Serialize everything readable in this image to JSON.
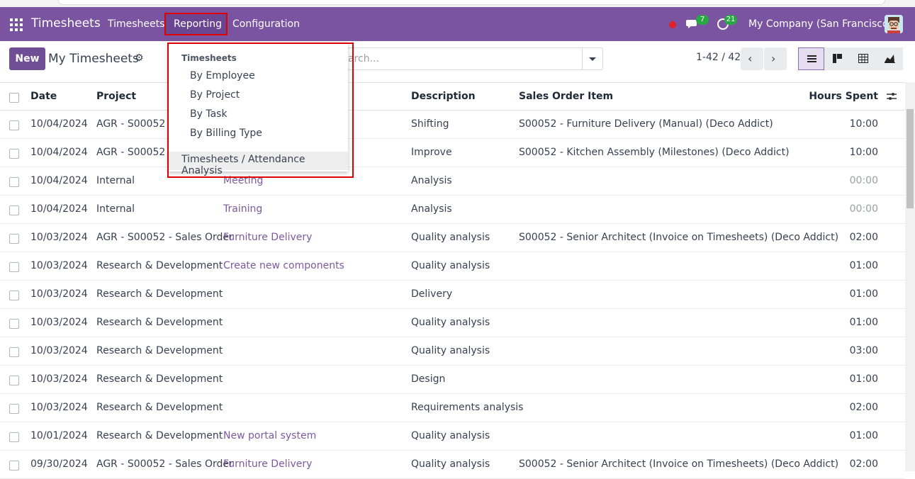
{
  "app": {
    "brand": "Timesheets",
    "menu": [
      "Timesheets",
      "Reporting",
      "Configuration"
    ],
    "chat_count": "7",
    "activity_count": "21",
    "company": "My Company (San Francisco)"
  },
  "control": {
    "new_label": "New",
    "page_title": "My Timesheets",
    "search_placeholder": "arch...",
    "pager": "1-42 / 42"
  },
  "table": {
    "headers": [
      "Date",
      "Project",
      "Description",
      "Sales Order Item",
      "Hours Spent"
    ],
    "rows": [
      {
        "date": "10/04/2024",
        "project": "AGR - S00052 - S",
        "task": "",
        "desc": "Shifting",
        "soi": "S00052 - Furniture Delivery (Manual) (Deco Addict)",
        "hours": "10:00"
      },
      {
        "date": "10/04/2024",
        "project": "AGR - S00052 - S",
        "task": "",
        "desc": "Improve",
        "soi": "S00052 - Kitchen Assembly (Milestones) (Deco Addict)",
        "hours": "10:00"
      },
      {
        "date": "10/04/2024",
        "project": "Internal",
        "task": "Meeting",
        "desc": "Analysis",
        "soi": "",
        "hours": "00:00"
      },
      {
        "date": "10/04/2024",
        "project": "Internal",
        "task": "Training",
        "desc": "Analysis",
        "soi": "",
        "hours": "00:00"
      },
      {
        "date": "10/03/2024",
        "project": "AGR - S00052 - Sales Order",
        "task": "Furniture Delivery",
        "desc": "Quality analysis",
        "soi": "S00052 - Senior Architect (Invoice on Timesheets) (Deco Addict)",
        "hours": "02:00"
      },
      {
        "date": "10/03/2024",
        "project": "Research & Development",
        "task": "Create new components",
        "desc": "Quality analysis",
        "soi": "",
        "hours": "01:00"
      },
      {
        "date": "10/03/2024",
        "project": "Research & Development",
        "task": "",
        "desc": "Delivery",
        "soi": "",
        "hours": "01:00"
      },
      {
        "date": "10/03/2024",
        "project": "Research & Development",
        "task": "",
        "desc": "Quality analysis",
        "soi": "",
        "hours": "01:00"
      },
      {
        "date": "10/03/2024",
        "project": "Research & Development",
        "task": "",
        "desc": "Quality analysis",
        "soi": "",
        "hours": "03:00"
      },
      {
        "date": "10/03/2024",
        "project": "Research & Development",
        "task": "",
        "desc": "Design",
        "soi": "",
        "hours": "01:00"
      },
      {
        "date": "10/03/2024",
        "project": "Research & Development",
        "task": "",
        "desc": "Requirements analysis",
        "soi": "",
        "hours": "02:00"
      },
      {
        "date": "10/01/2024",
        "project": "Research & Development",
        "task": "New portal system",
        "desc": "Quality analysis",
        "soi": "",
        "hours": "01:00"
      },
      {
        "date": "09/30/2024",
        "project": "AGR - S00052 - Sales Order",
        "task": "Furniture Delivery",
        "desc": "Quality analysis",
        "soi": "S00052 - Senior Architect (Invoice on Timesheets) (Deco Addict)",
        "hours": "02:00"
      }
    ]
  },
  "reporting_menu": {
    "section": "Timesheets",
    "items": [
      "By Employee",
      "By Project",
      "By Task",
      "By Billing Type"
    ],
    "analysis": "Timesheets / Attendance Analysis"
  },
  "colors": {
    "topbar": "#7a54a0",
    "accent": "#6f4e95",
    "highlight": "#e00000",
    "badge": "#28a745"
  }
}
